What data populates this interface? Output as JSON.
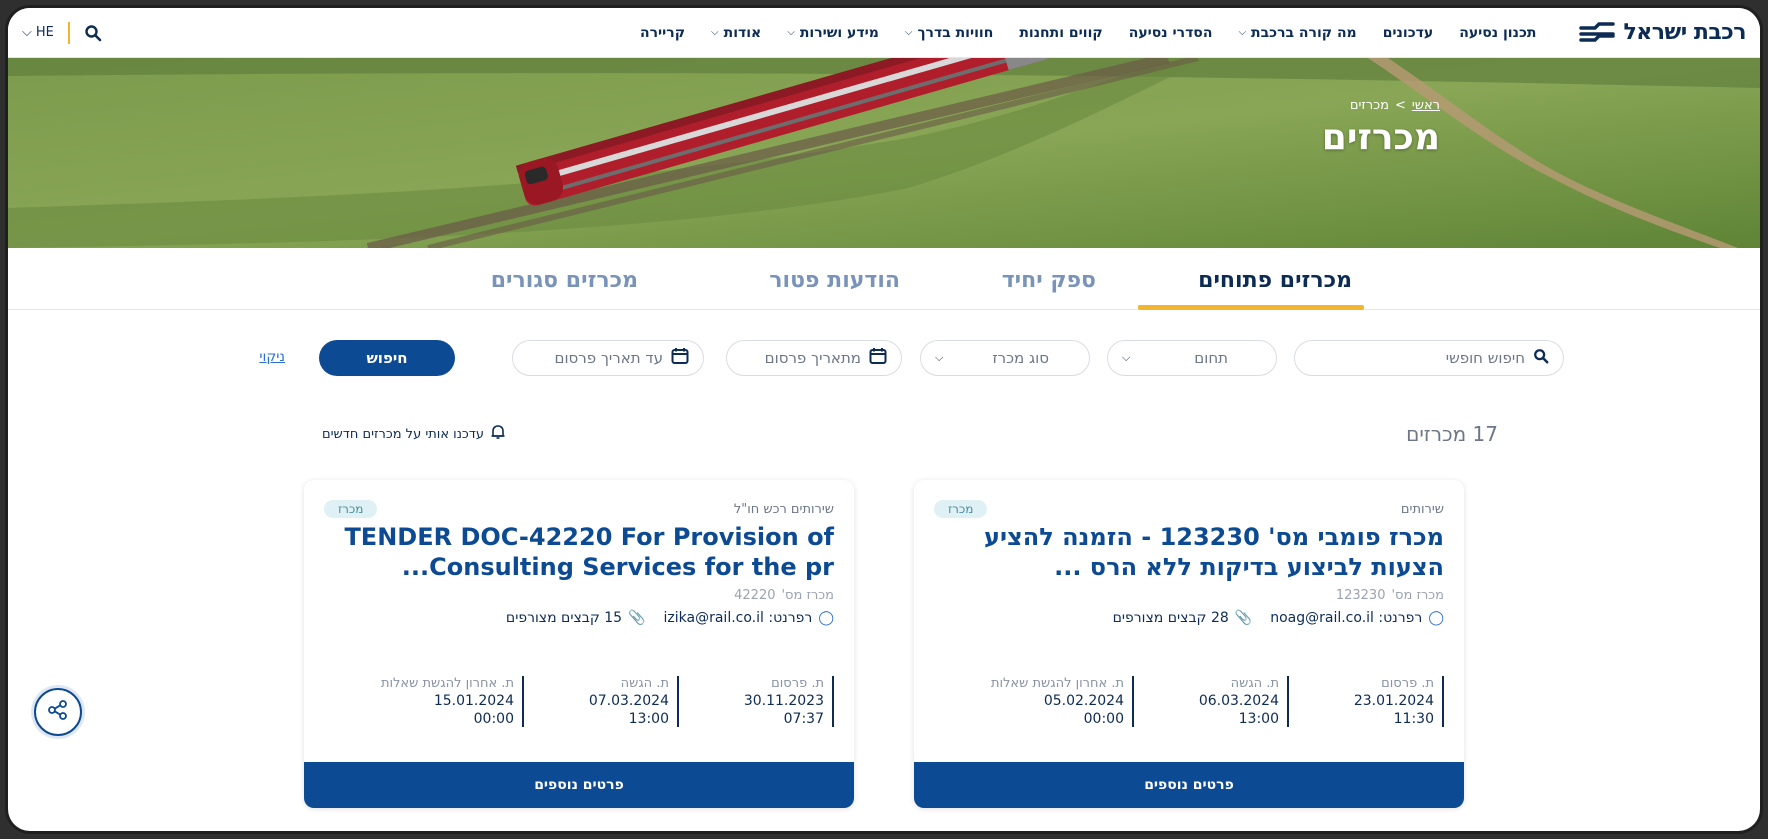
{
  "brand": {
    "logo_text": "רכבת ישראל",
    "accent": "#f2b52d",
    "primary": "#0d4a94"
  },
  "nav": {
    "items": [
      {
        "label": "תכנון נסיעה",
        "caret": false
      },
      {
        "label": "עדכונים",
        "caret": false
      },
      {
        "label": "מה קורה ברכבת",
        "caret": true
      },
      {
        "label": "הסדרי נסיעה",
        "caret": false
      },
      {
        "label": "קווים ותחנות",
        "caret": false
      },
      {
        "label": "חוויות בדרך",
        "caret": true
      },
      {
        "label": "מידע ושירות",
        "caret": true
      },
      {
        "label": "אודות",
        "caret": true
      },
      {
        "label": "קריירה",
        "caret": false
      }
    ],
    "lang": "HE"
  },
  "hero": {
    "breadcrumb_home": "ראשי",
    "breadcrumb_sep": ">",
    "breadcrumb_current": "מכרזים",
    "title": "מכרזים"
  },
  "tabs": [
    "מכרזים פתוחים",
    "ספק יחיד",
    "הודעות פטור",
    "מכרזים סגורים"
  ],
  "filters": {
    "free_search_placeholder": "חיפוש חופשי",
    "domain": "תחום",
    "tender_type": "סוג מכרז",
    "from_date": "מתאריך פרסום",
    "to_date": "עד תאריך פרסום",
    "search_button": "חיפוש",
    "clear": "ניקוי"
  },
  "results": {
    "count": "17 מכרזים",
    "notify": "עדכנו אותי על מכרזים חדשים"
  },
  "cards": [
    {
      "category": "שירותים",
      "badge": "מכרז",
      "title": "מכרז פומבי מס' 123230 - הזמנה להציע הצעות לביצוע בדיקות ללא הרס ...",
      "tender_label": "מכרז מס'",
      "tender_no": "123230",
      "contact": "רפרנט: noag@rail.co.il",
      "files": "28 קבצים מצורפים",
      "dates": [
        {
          "label": "ת. פרסום",
          "date": "23.01.2024",
          "time": "11:30"
        },
        {
          "label": "ת. הגשה",
          "date": "06.03.2024",
          "time": "13:00"
        },
        {
          "label": "ת. אחרון להגשת שאלות",
          "date": "05.02.2024",
          "time": "00:00"
        }
      ],
      "button": "פרטים נוספים"
    },
    {
      "category": "שירותים רכש חו\"ל",
      "badge": "מכרז",
      "title": "TENDER DOC-42220 For Provision of Consulting Services for the pr...",
      "tender_label": "מכרז מס'",
      "tender_no": "42220",
      "contact": "רפרנט: izika@rail.co.il",
      "files": "15 קבצים מצורפים",
      "dates": [
        {
          "label": "ת. פרסום",
          "date": "30.11.2023",
          "time": "07:37"
        },
        {
          "label": "ת. הגשה",
          "date": "07.03.2024",
          "time": "13:00"
        },
        {
          "label": "ת. אחרון להגשת שאלות",
          "date": "15.01.2024",
          "time": "00:00"
        }
      ],
      "button": "פרטים נוספים"
    }
  ]
}
